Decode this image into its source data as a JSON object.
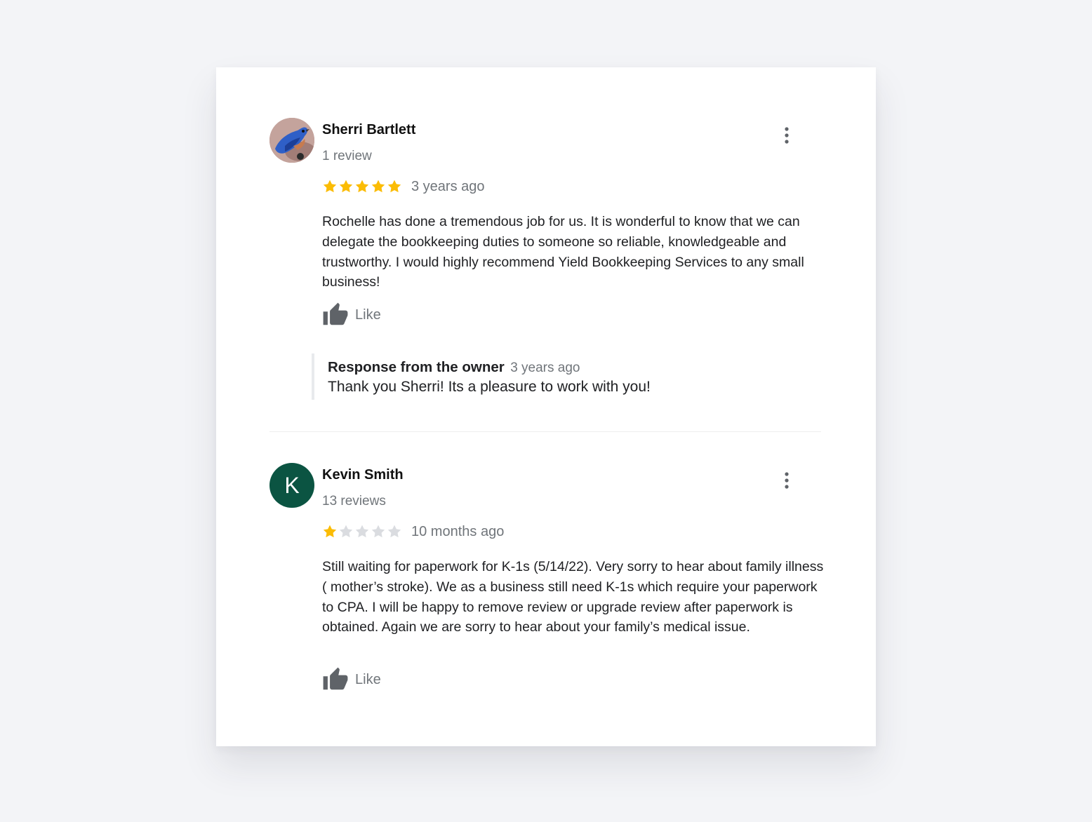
{
  "reviews": [
    {
      "reviewer_name": "Sherri Bartlett",
      "review_count": "1 review",
      "avatar": "bluebird-photo-avatar",
      "rating": 5,
      "max_rating": 5,
      "date": "3 years ago",
      "text": "Rochelle has done a tremendous job for us. It is wonderful to know that we can delegate the bookkeeping duties to someone so reliable, knowledgeable and trustworthy. I would highly recommend Yield Bookkeeping Services to any small business!",
      "like_label": "Like",
      "owner_response": {
        "title": "Response from the owner",
        "date": "3 years ago",
        "text": "Thank you Sherri! Its a pleasure to work with you!"
      }
    },
    {
      "reviewer_name": "Kevin Smith",
      "review_count": "13 reviews",
      "avatar_letter": "K",
      "rating": 1,
      "max_rating": 5,
      "date": "10 months ago",
      "text": "Still waiting for paperwork for K-1s (5/14/22). Very sorry to hear about family illness ( mother’s stroke). We as a business still need K-1s which require your paperwork to CPA. I will be happy to remove review or upgrade review after paperwork is obtained. Again we are sorry to hear about your family’s medical issue.",
      "like_label": "Like"
    }
  ],
  "colors": {
    "star_filled": "#fbbc04",
    "star_empty": "#dadce0",
    "avatar_k_background": "#0b5442",
    "secondary_text": "#70757a",
    "page_background": "#f3f4f7"
  }
}
